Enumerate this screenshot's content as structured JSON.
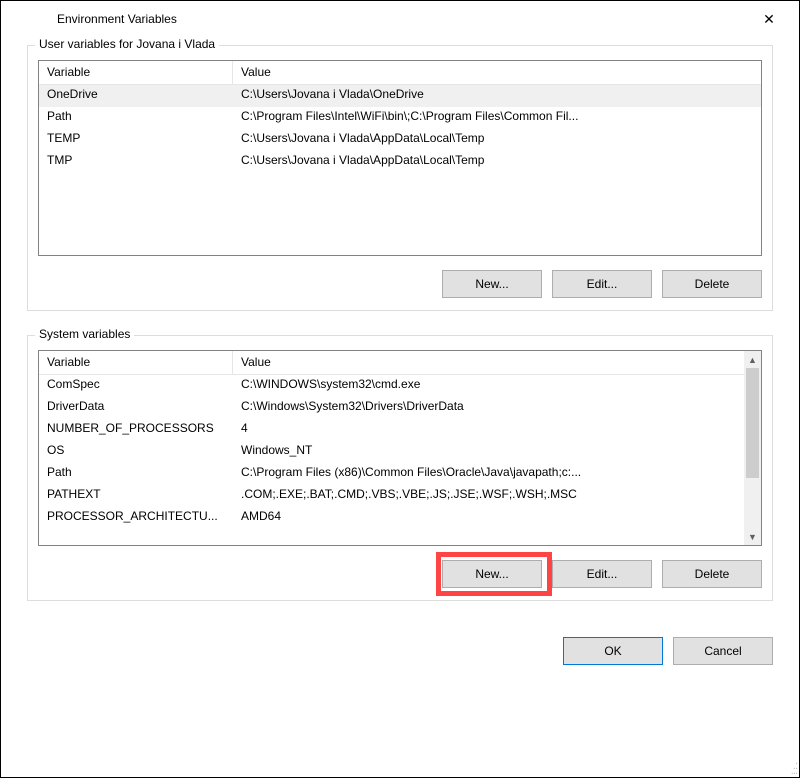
{
  "window": {
    "title": "Environment Variables",
    "close_icon": "✕"
  },
  "userGroup": {
    "label": "User variables for Jovana i Vlada",
    "headers": {
      "variable": "Variable",
      "value": "Value"
    },
    "rows": [
      {
        "variable": "OneDrive",
        "value": "C:\\Users\\Jovana i Vlada\\OneDrive"
      },
      {
        "variable": "Path",
        "value": "C:\\Program Files\\Intel\\WiFi\\bin\\;C:\\Program Files\\Common Fil..."
      },
      {
        "variable": "TEMP",
        "value": "C:\\Users\\Jovana i Vlada\\AppData\\Local\\Temp"
      },
      {
        "variable": "TMP",
        "value": "C:\\Users\\Jovana i Vlada\\AppData\\Local\\Temp"
      }
    ],
    "buttons": {
      "new": "New...",
      "edit": "Edit...",
      "delete": "Delete"
    }
  },
  "systemGroup": {
    "label": "System variables",
    "headers": {
      "variable": "Variable",
      "value": "Value"
    },
    "rows": [
      {
        "variable": "ComSpec",
        "value": "C:\\WINDOWS\\system32\\cmd.exe"
      },
      {
        "variable": "DriverData",
        "value": "C:\\Windows\\System32\\Drivers\\DriverData"
      },
      {
        "variable": "NUMBER_OF_PROCESSORS",
        "value": "4"
      },
      {
        "variable": "OS",
        "value": "Windows_NT"
      },
      {
        "variable": "Path",
        "value": "C:\\Program Files (x86)\\Common Files\\Oracle\\Java\\javapath;c:..."
      },
      {
        "variable": "PATHEXT",
        "value": ".COM;.EXE;.BAT;.CMD;.VBS;.VBE;.JS;.JSE;.WSF;.WSH;.MSC"
      },
      {
        "variable": "PROCESSOR_ARCHITECTU...",
        "value": "AMD64"
      }
    ],
    "buttons": {
      "new": "New...",
      "edit": "Edit...",
      "delete": "Delete"
    }
  },
  "dialogButtons": {
    "ok": "OK",
    "cancel": "Cancel"
  },
  "scrollArrows": {
    "up": "▲",
    "down": "▼"
  }
}
